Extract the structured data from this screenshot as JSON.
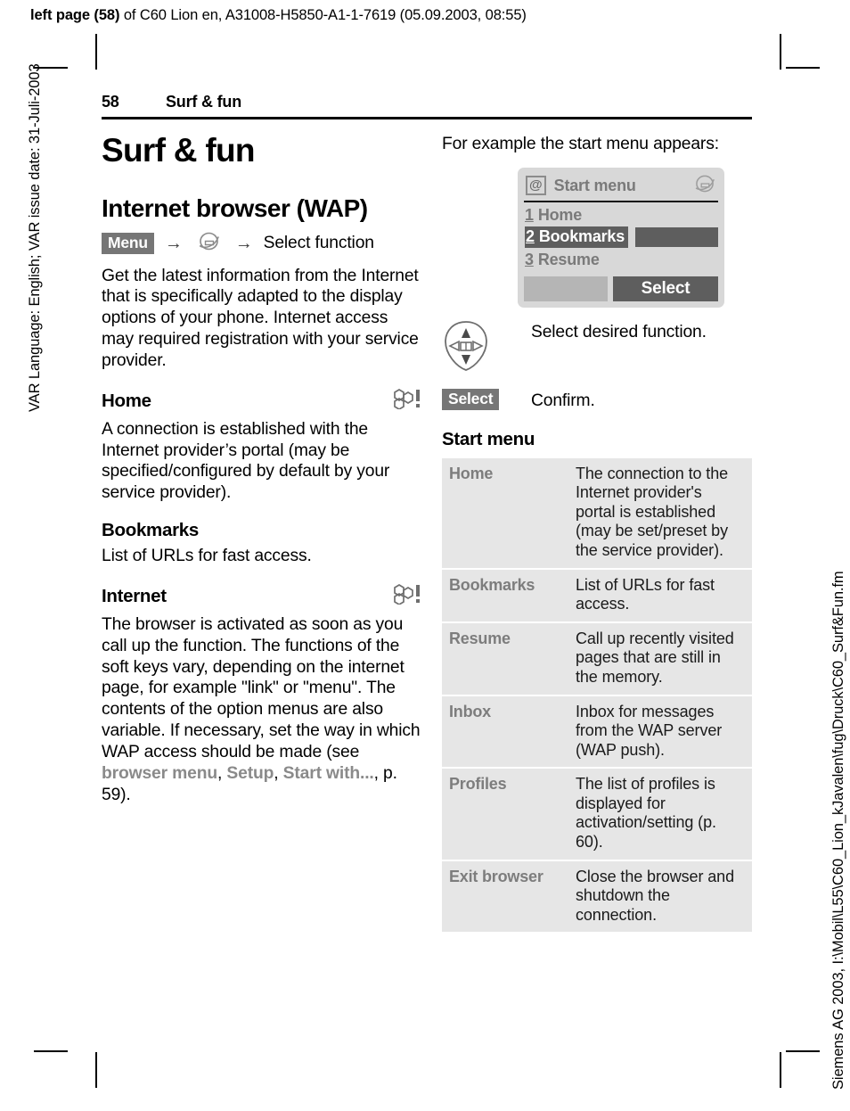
{
  "proof_header": {
    "bold_prefix": "left page (58)",
    "rest": " of C60 Lion en, A31008-H5850-A1-1-7619 (05.09.2003, 08:55)"
  },
  "margins": {
    "left_text": "VAR Language: English; VAR issue date: 31-Juli-2003",
    "right_text": "Siemens AG 2003, I:\\Mobil\\L55\\C60_Lion_kJavalen\\fug\\Druck\\C60_Surf&Fun.fm"
  },
  "running_head": {
    "page_number": "58",
    "chapter": "Surf & fun"
  },
  "left_column": {
    "chapter_title": "Surf & fun",
    "section_title": "Internet browser (WAP)",
    "menu_path": {
      "softkey_label": "Menu",
      "arrow": "→",
      "browser_icon": "wap-browser-icon",
      "final_label": "Select function"
    },
    "intro_paragraph": "Get the latest information from the Internet that is specifically adapted to the display options of your phone. Internet access may required registration with your service provider.",
    "subsections": [
      {
        "title": "Home",
        "has_provider_icon": true,
        "body": "A connection is established with the Internet provider’s portal (may be specified/configured by default by your service provider)."
      },
      {
        "title": "Bookmarks",
        "has_provider_icon": false,
        "body": "List of URLs for fast access."
      },
      {
        "title": "Internet",
        "has_provider_icon": true,
        "body_part1": "The browser is activated as soon as you call up the function. The functions of the soft keys vary, depending on the internet page, for example \"link\" or \"menu\". The contents of the option menus are also variable. If necessary, set the way in which WAP access should be made (see ",
        "body_ref1": "browser menu",
        "body_part2": ", ",
        "body_ref2": "Setup",
        "body_part3": ", ",
        "body_ref3": "Start with...",
        "body_part4": ", p. 59)."
      }
    ]
  },
  "right_column": {
    "intro_line": "For example the start menu appears:",
    "phone_display": {
      "at_symbol": "@",
      "title": "Start menu",
      "browser_icon": "wap-browser-icon",
      "items": [
        {
          "number": "1",
          "label": "Home",
          "selected": false
        },
        {
          "number": "2",
          "label": "Bookmarks",
          "selected": true
        },
        {
          "number": "3",
          "label": "Resume",
          "selected": false
        }
      ],
      "softkey_left": "",
      "softkey_right": "Select"
    },
    "key_rows": [
      {
        "key_icon": "navigation-key-icon",
        "key_label": "",
        "description": "Select desired function."
      },
      {
        "key_icon": "softkey",
        "key_label": "Select",
        "description": "Confirm."
      }
    ],
    "table_heading": "Start menu",
    "table": {
      "rows": [
        {
          "term": "Home",
          "definition": "The connection to the Internet provider's portal is established (may be set/preset by the service provider)."
        },
        {
          "term": "Bookmarks",
          "definition": "List of URLs for fast access."
        },
        {
          "term": "Resume",
          "definition": "Call up recently visited pages that are still in the memory."
        },
        {
          "term": "Inbox",
          "definition": "Inbox for messages from the WAP server (WAP push)."
        },
        {
          "term": "Profiles",
          "definition": "The list of profiles is displayed for activation/setting (p. 60)."
        },
        {
          "term": "Exit browser",
          "definition": "Close the browser and shutdown the connection."
        }
      ]
    }
  },
  "colors": {
    "softkey_bg": "#767676",
    "display_bg": "#d8d8d8",
    "display_text": "#7a7a7a",
    "selected_bg": "#5e5e5e",
    "table_bg": "#e6e6e6",
    "table_term": "#7d7d7d",
    "reference_text": "#8a8a8a"
  }
}
